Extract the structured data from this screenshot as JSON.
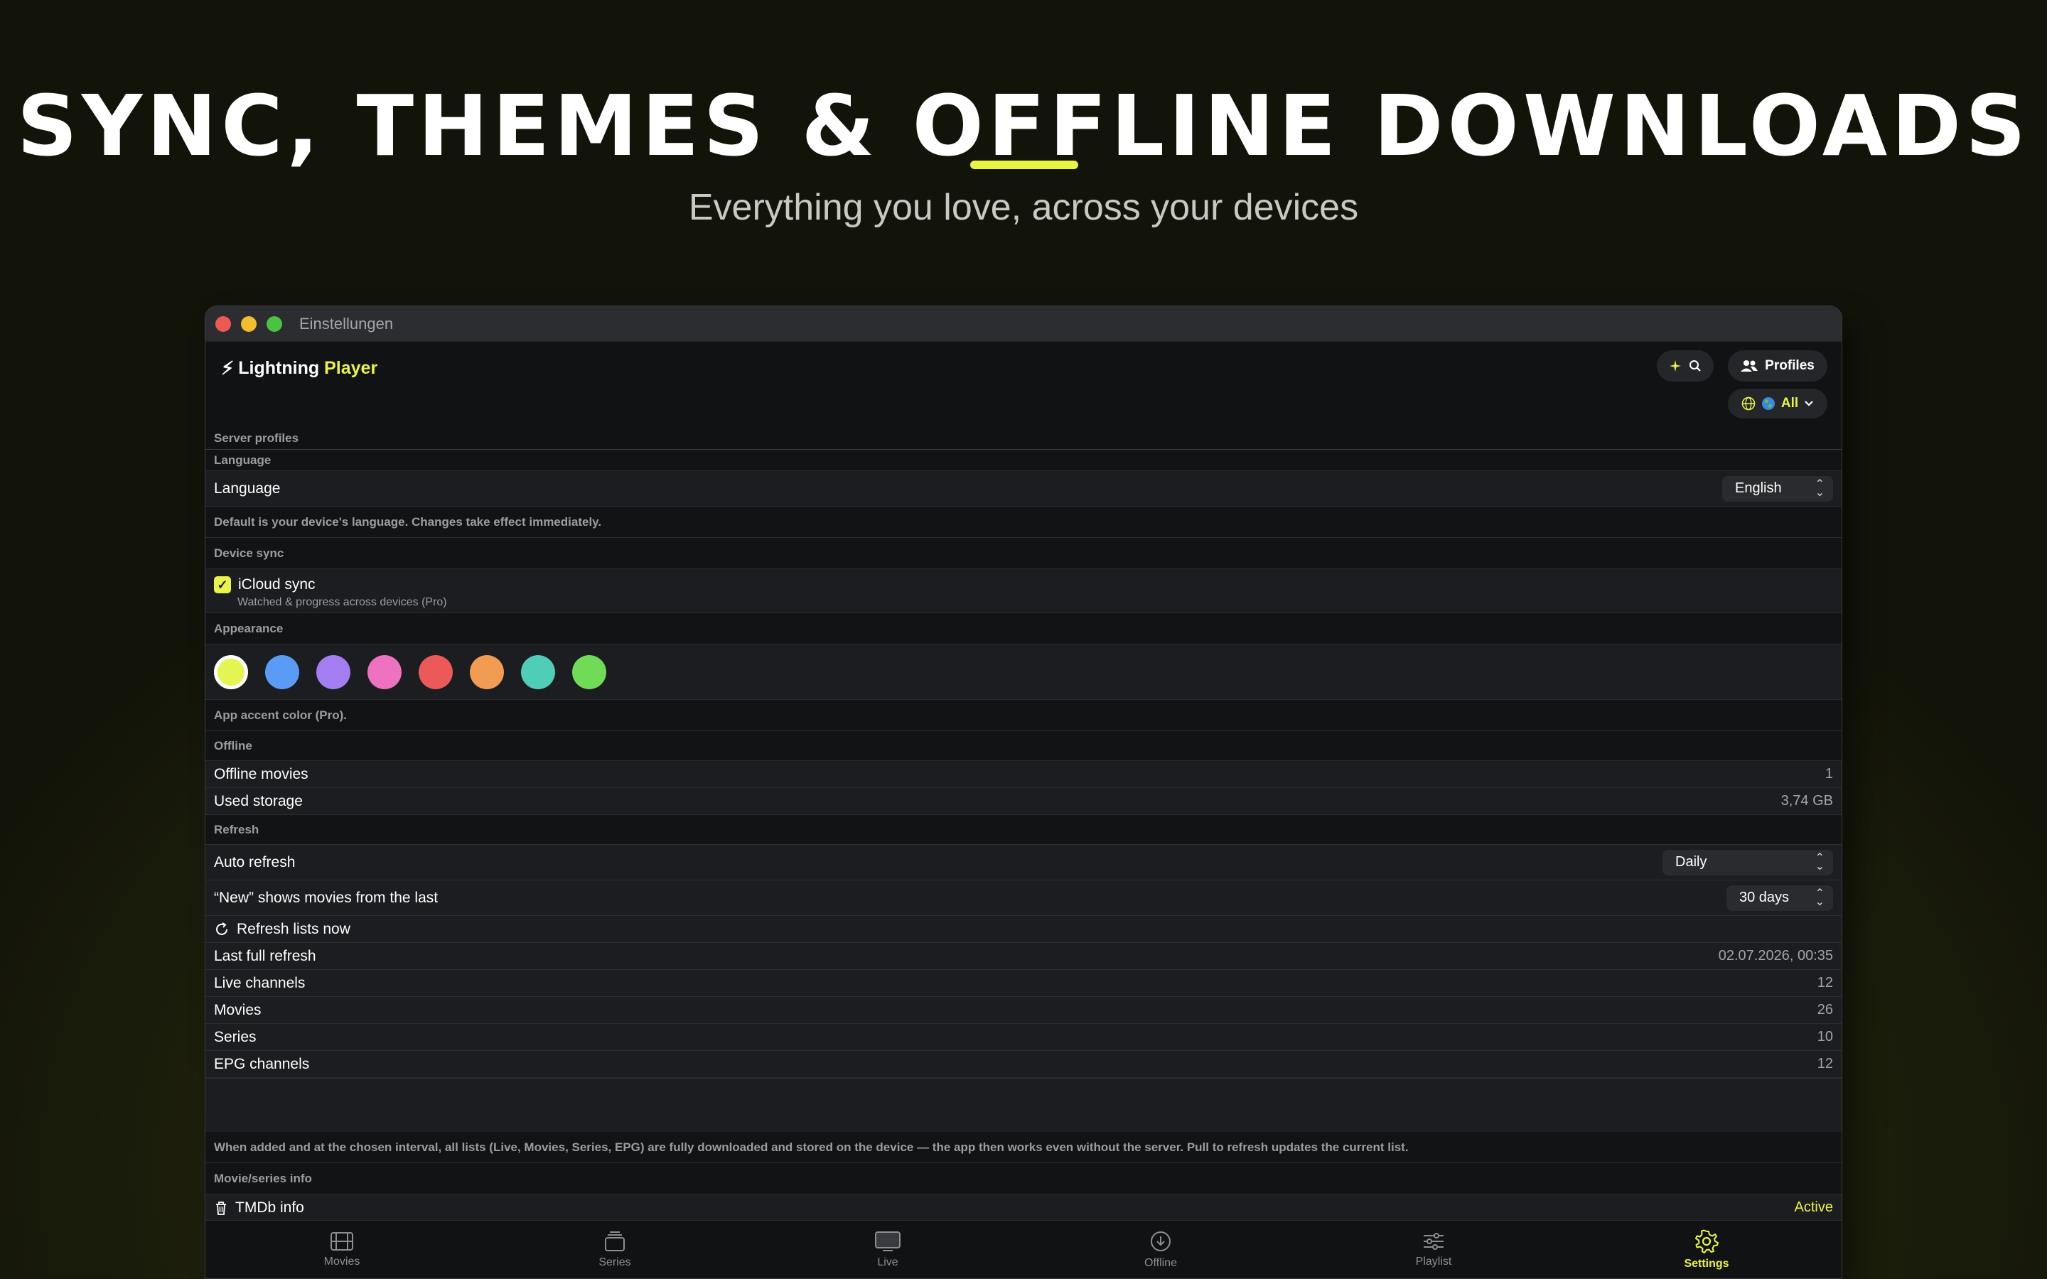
{
  "hero": {
    "title": "SYNC, THEMES & OFFLINE DOWNLOADS",
    "subtitle": "Everything you love, across your devices"
  },
  "window": {
    "title": "Einstellungen"
  },
  "app": {
    "brand_name": "Lightning",
    "brand_accent": "Player",
    "profiles_label": "Profiles",
    "filter_label": "All"
  },
  "settings": {
    "server_profiles": "Server profiles",
    "language_section": "Language",
    "language_label": "Language",
    "language_value": "English",
    "language_note": "Default is your device's language. Changes take effect immediately.",
    "sync_section": "Device sync",
    "icloud_label": "iCloud sync",
    "icloud_sub": "Watched & progress across devices (Pro)",
    "icloud_checked": true,
    "appearance_section": "Appearance",
    "accent_colors": [
      "#e4f551",
      "#5a9cf5",
      "#a47ef0",
      "#ee72c0",
      "#ec5959",
      "#f29b52",
      "#4fcdb7",
      "#6fdb57"
    ],
    "accent_note": "App accent color (Pro).",
    "offline_section": "Offline",
    "offline_movies_label": "Offline movies",
    "offline_movies_value": "1",
    "used_storage_label": "Used storage",
    "used_storage_value": "3,74 GB",
    "refresh_section": "Refresh",
    "auto_refresh_label": "Auto refresh",
    "auto_refresh_value": "Daily",
    "new_shows_label": "“New” shows movies from the last",
    "new_shows_value": "30 days",
    "refresh_now_label": "Refresh lists now",
    "last_refresh_label": "Last full refresh",
    "last_refresh_value": "02.07.2026, 00:35",
    "live_channels_label": "Live channels",
    "live_channels_value": "12",
    "movies_label": "Movies",
    "movies_value": "26",
    "series_label": "Series",
    "series_value": "10",
    "epg_label": "EPG channels",
    "epg_value": "12",
    "refresh_note": "When added and at the chosen interval, all lists (Live, Movies, Series, EPG) are fully downloaded and stored on the device — the app then works even without the server. Pull to refresh updates the current list.",
    "info_section": "Movie/series info",
    "tmdb_label": "TMDb info",
    "tmdb_value": "Active"
  },
  "tabs": [
    {
      "label": "Movies"
    },
    {
      "label": "Series"
    },
    {
      "label": "Live"
    },
    {
      "label": "Offline"
    },
    {
      "label": "Playlist"
    },
    {
      "label": "Settings"
    }
  ],
  "colors": {
    "accent": "#e9f542",
    "background": "#1c1d20"
  }
}
